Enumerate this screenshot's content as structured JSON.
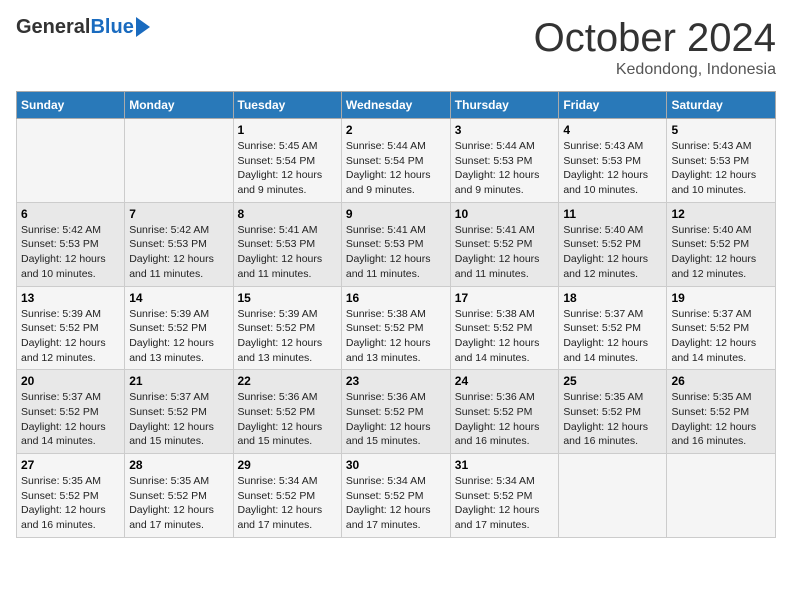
{
  "logo": {
    "general": "General",
    "blue": "Blue"
  },
  "header": {
    "month": "October 2024",
    "location": "Kedondong, Indonesia"
  },
  "weekdays": [
    "Sunday",
    "Monday",
    "Tuesday",
    "Wednesday",
    "Thursday",
    "Friday",
    "Saturday"
  ],
  "weeks": [
    [
      {
        "day": "",
        "sunrise": "",
        "sunset": "",
        "daylight": ""
      },
      {
        "day": "",
        "sunrise": "",
        "sunset": "",
        "daylight": ""
      },
      {
        "day": "1",
        "sunrise": "Sunrise: 5:45 AM",
        "sunset": "Sunset: 5:54 PM",
        "daylight": "Daylight: 12 hours and 9 minutes."
      },
      {
        "day": "2",
        "sunrise": "Sunrise: 5:44 AM",
        "sunset": "Sunset: 5:54 PM",
        "daylight": "Daylight: 12 hours and 9 minutes."
      },
      {
        "day": "3",
        "sunrise": "Sunrise: 5:44 AM",
        "sunset": "Sunset: 5:53 PM",
        "daylight": "Daylight: 12 hours and 9 minutes."
      },
      {
        "day": "4",
        "sunrise": "Sunrise: 5:43 AM",
        "sunset": "Sunset: 5:53 PM",
        "daylight": "Daylight: 12 hours and 10 minutes."
      },
      {
        "day": "5",
        "sunrise": "Sunrise: 5:43 AM",
        "sunset": "Sunset: 5:53 PM",
        "daylight": "Daylight: 12 hours and 10 minutes."
      }
    ],
    [
      {
        "day": "6",
        "sunrise": "Sunrise: 5:42 AM",
        "sunset": "Sunset: 5:53 PM",
        "daylight": "Daylight: 12 hours and 10 minutes."
      },
      {
        "day": "7",
        "sunrise": "Sunrise: 5:42 AM",
        "sunset": "Sunset: 5:53 PM",
        "daylight": "Daylight: 12 hours and 11 minutes."
      },
      {
        "day": "8",
        "sunrise": "Sunrise: 5:41 AM",
        "sunset": "Sunset: 5:53 PM",
        "daylight": "Daylight: 12 hours and 11 minutes."
      },
      {
        "day": "9",
        "sunrise": "Sunrise: 5:41 AM",
        "sunset": "Sunset: 5:53 PM",
        "daylight": "Daylight: 12 hours and 11 minutes."
      },
      {
        "day": "10",
        "sunrise": "Sunrise: 5:41 AM",
        "sunset": "Sunset: 5:52 PM",
        "daylight": "Daylight: 12 hours and 11 minutes."
      },
      {
        "day": "11",
        "sunrise": "Sunrise: 5:40 AM",
        "sunset": "Sunset: 5:52 PM",
        "daylight": "Daylight: 12 hours and 12 minutes."
      },
      {
        "day": "12",
        "sunrise": "Sunrise: 5:40 AM",
        "sunset": "Sunset: 5:52 PM",
        "daylight": "Daylight: 12 hours and 12 minutes."
      }
    ],
    [
      {
        "day": "13",
        "sunrise": "Sunrise: 5:39 AM",
        "sunset": "Sunset: 5:52 PM",
        "daylight": "Daylight: 12 hours and 12 minutes."
      },
      {
        "day": "14",
        "sunrise": "Sunrise: 5:39 AM",
        "sunset": "Sunset: 5:52 PM",
        "daylight": "Daylight: 12 hours and 13 minutes."
      },
      {
        "day": "15",
        "sunrise": "Sunrise: 5:39 AM",
        "sunset": "Sunset: 5:52 PM",
        "daylight": "Daylight: 12 hours and 13 minutes."
      },
      {
        "day": "16",
        "sunrise": "Sunrise: 5:38 AM",
        "sunset": "Sunset: 5:52 PM",
        "daylight": "Daylight: 12 hours and 13 minutes."
      },
      {
        "day": "17",
        "sunrise": "Sunrise: 5:38 AM",
        "sunset": "Sunset: 5:52 PM",
        "daylight": "Daylight: 12 hours and 14 minutes."
      },
      {
        "day": "18",
        "sunrise": "Sunrise: 5:37 AM",
        "sunset": "Sunset: 5:52 PM",
        "daylight": "Daylight: 12 hours and 14 minutes."
      },
      {
        "day": "19",
        "sunrise": "Sunrise: 5:37 AM",
        "sunset": "Sunset: 5:52 PM",
        "daylight": "Daylight: 12 hours and 14 minutes."
      }
    ],
    [
      {
        "day": "20",
        "sunrise": "Sunrise: 5:37 AM",
        "sunset": "Sunset: 5:52 PM",
        "daylight": "Daylight: 12 hours and 14 minutes."
      },
      {
        "day": "21",
        "sunrise": "Sunrise: 5:37 AM",
        "sunset": "Sunset: 5:52 PM",
        "daylight": "Daylight: 12 hours and 15 minutes."
      },
      {
        "day": "22",
        "sunrise": "Sunrise: 5:36 AM",
        "sunset": "Sunset: 5:52 PM",
        "daylight": "Daylight: 12 hours and 15 minutes."
      },
      {
        "day": "23",
        "sunrise": "Sunrise: 5:36 AM",
        "sunset": "Sunset: 5:52 PM",
        "daylight": "Daylight: 12 hours and 15 minutes."
      },
      {
        "day": "24",
        "sunrise": "Sunrise: 5:36 AM",
        "sunset": "Sunset: 5:52 PM",
        "daylight": "Daylight: 12 hours and 16 minutes."
      },
      {
        "day": "25",
        "sunrise": "Sunrise: 5:35 AM",
        "sunset": "Sunset: 5:52 PM",
        "daylight": "Daylight: 12 hours and 16 minutes."
      },
      {
        "day": "26",
        "sunrise": "Sunrise: 5:35 AM",
        "sunset": "Sunset: 5:52 PM",
        "daylight": "Daylight: 12 hours and 16 minutes."
      }
    ],
    [
      {
        "day": "27",
        "sunrise": "Sunrise: 5:35 AM",
        "sunset": "Sunset: 5:52 PM",
        "daylight": "Daylight: 12 hours and 16 minutes."
      },
      {
        "day": "28",
        "sunrise": "Sunrise: 5:35 AM",
        "sunset": "Sunset: 5:52 PM",
        "daylight": "Daylight: 12 hours and 17 minutes."
      },
      {
        "day": "29",
        "sunrise": "Sunrise: 5:34 AM",
        "sunset": "Sunset: 5:52 PM",
        "daylight": "Daylight: 12 hours and 17 minutes."
      },
      {
        "day": "30",
        "sunrise": "Sunrise: 5:34 AM",
        "sunset": "Sunset: 5:52 PM",
        "daylight": "Daylight: 12 hours and 17 minutes."
      },
      {
        "day": "31",
        "sunrise": "Sunrise: 5:34 AM",
        "sunset": "Sunset: 5:52 PM",
        "daylight": "Daylight: 12 hours and 17 minutes."
      },
      {
        "day": "",
        "sunrise": "",
        "sunset": "",
        "daylight": ""
      },
      {
        "day": "",
        "sunrise": "",
        "sunset": "",
        "daylight": ""
      }
    ]
  ]
}
